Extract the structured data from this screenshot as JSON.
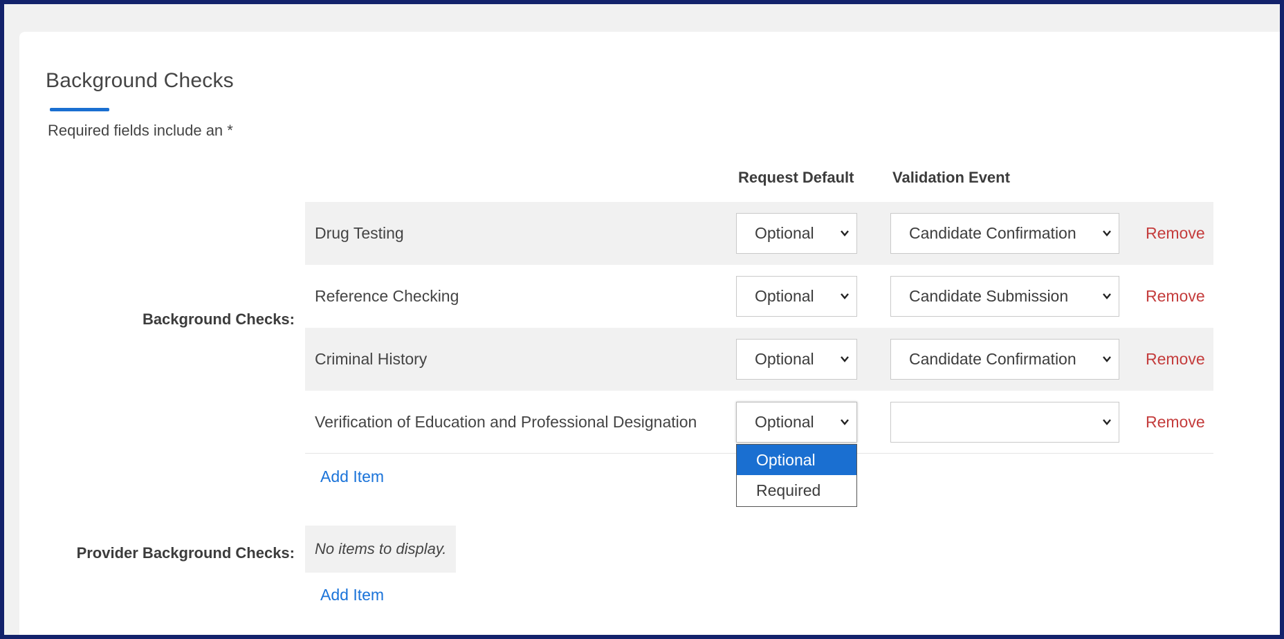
{
  "page": {
    "title": "Background Checks",
    "required_note": "Required fields include an *"
  },
  "columns": {
    "request_default": "Request Default",
    "validation_event": "Validation Event"
  },
  "background_checks": {
    "label": "Background Checks:",
    "rows": [
      {
        "name": "Drug Testing",
        "default": "Optional",
        "event": "Candidate Confirmation",
        "remove": "Remove"
      },
      {
        "name": "Reference Checking",
        "default": "Optional",
        "event": "Candidate Submission",
        "remove": "Remove"
      },
      {
        "name": "Criminal History",
        "default": "Optional",
        "event": "Candidate Confirmation",
        "remove": "Remove"
      },
      {
        "name": "Verification of Education and Professional Designation",
        "default": "Optional",
        "event": "",
        "remove": "Remove"
      }
    ],
    "add_item": "Add Item"
  },
  "dropdown": {
    "options": [
      "Optional",
      "Required"
    ],
    "selected": "Optional"
  },
  "provider_background_checks": {
    "label": "Provider Background Checks:",
    "empty_text": "No items to display.",
    "add_item": "Add Item"
  },
  "colors": {
    "accent": "#1a6fd1",
    "remove": "#c43c3c",
    "link": "#1a73d9",
    "frame_border": "#13226b"
  }
}
